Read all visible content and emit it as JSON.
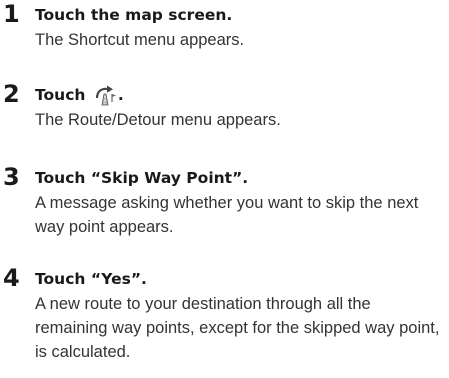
{
  "steps": [
    {
      "number": "1",
      "title": "Touch the map screen.",
      "description": "The Shortcut menu appears."
    },
    {
      "number": "2",
      "title_prefix": "Touch",
      "title_suffix": ".",
      "icon": "route-detour-icon",
      "description": "The Route/Detour menu appears."
    },
    {
      "number": "3",
      "title": "Touch “Skip Way Point”.",
      "description": "A message asking whether you want to skip the next way point appears."
    },
    {
      "number": "4",
      "title": "Touch “Yes”.",
      "description": "A new route to your destination through all the remaining way points, except for the skipped way point, is calculated."
    }
  ]
}
